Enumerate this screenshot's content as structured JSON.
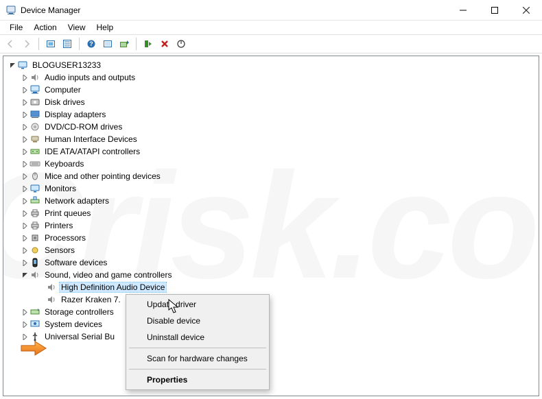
{
  "window": {
    "title": "Device Manager"
  },
  "menubar": [
    "File",
    "Action",
    "View",
    "Help"
  ],
  "tree": {
    "root": {
      "label": "BLOGUSER13233",
      "expanded": true
    },
    "categories": [
      {
        "label": "Audio inputs and outputs",
        "icon": "speaker",
        "expanded": false
      },
      {
        "label": "Computer",
        "icon": "computer",
        "expanded": false
      },
      {
        "label": "Disk drives",
        "icon": "disk",
        "expanded": false
      },
      {
        "label": "Display adapters",
        "icon": "display",
        "expanded": false
      },
      {
        "label": "DVD/CD-ROM drives",
        "icon": "dvd",
        "expanded": false
      },
      {
        "label": "Human Interface Devices",
        "icon": "hid",
        "expanded": false
      },
      {
        "label": "IDE ATA/ATAPI controllers",
        "icon": "ide",
        "expanded": false
      },
      {
        "label": "Keyboards",
        "icon": "keyboard",
        "expanded": false
      },
      {
        "label": "Mice and other pointing devices",
        "icon": "mouse",
        "expanded": false
      },
      {
        "label": "Monitors",
        "icon": "monitor",
        "expanded": false
      },
      {
        "label": "Network adapters",
        "icon": "network",
        "expanded": false
      },
      {
        "label": "Print queues",
        "icon": "printer",
        "expanded": false
      },
      {
        "label": "Printers",
        "icon": "printer",
        "expanded": false
      },
      {
        "label": "Processors",
        "icon": "cpu",
        "expanded": false
      },
      {
        "label": "Sensors",
        "icon": "sensor",
        "expanded": false
      },
      {
        "label": "Software devices",
        "icon": "software",
        "expanded": false
      },
      {
        "label": "Sound, video and game controllers",
        "icon": "speaker",
        "expanded": true,
        "children": [
          {
            "label": "High Definition Audio Device",
            "icon": "speaker",
            "selected": true
          },
          {
            "label": "Razer Kraken 7.",
            "icon": "speaker",
            "truncated": true
          }
        ]
      },
      {
        "label": "Storage controllers",
        "icon": "storage",
        "expanded": false
      },
      {
        "label": "System devices",
        "icon": "system",
        "expanded": false
      },
      {
        "label": "Universal Serial Bu",
        "icon": "usb",
        "expanded": false,
        "truncated": true
      }
    ]
  },
  "context_menu": {
    "items": [
      {
        "label": "Update driver",
        "type": "item"
      },
      {
        "label": "Disable device",
        "type": "item"
      },
      {
        "label": "Uninstall device",
        "type": "item"
      },
      {
        "type": "sep"
      },
      {
        "label": "Scan for hardware changes",
        "type": "item"
      },
      {
        "type": "sep"
      },
      {
        "label": "Properties",
        "type": "item",
        "bold": true
      }
    ]
  },
  "watermark": "PCrisk.com"
}
